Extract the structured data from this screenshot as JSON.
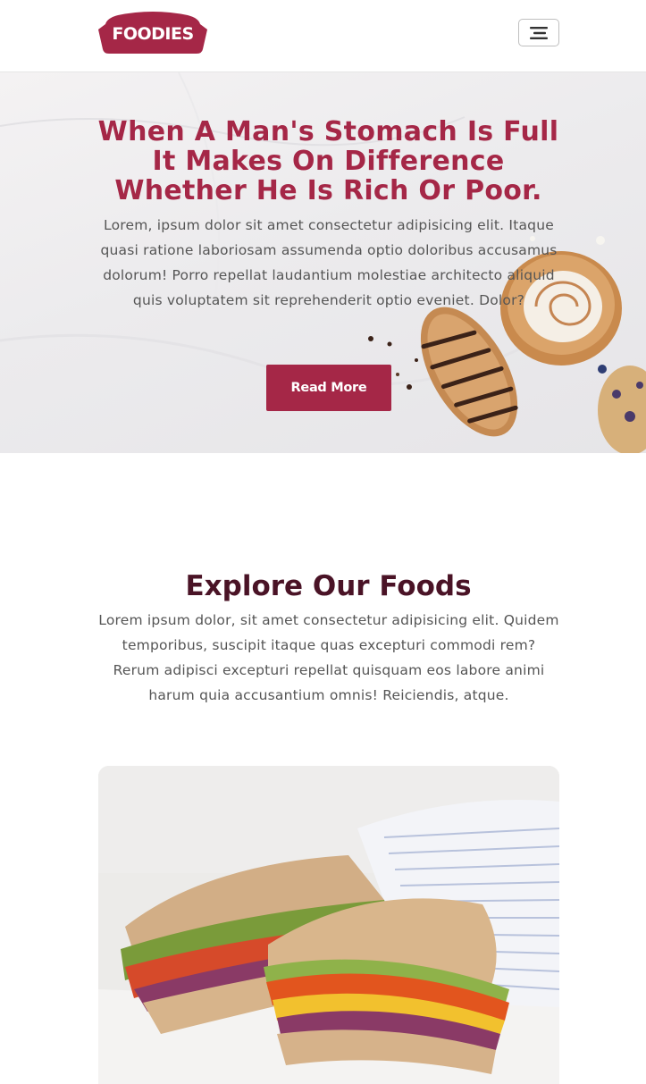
{
  "brand": {
    "name": "FOODIES",
    "color": "#a52747"
  },
  "header": {
    "menu_icon": "hamburger-icon"
  },
  "hero": {
    "title": "When A Man's Stomach Is Full It Makes On Difference Whether He Is Rich Or Poor.",
    "text": "Lorem, ipsum dolor sit amet consectetur adipisicing elit. Itaque quasi ratione laboriosam assumenda optio doloribus accusamus dolorum! Porro repellat laudantium molestiae architecto aliquid quis voluptatem sit reprehenderit optio eveniet. Dolor?",
    "button_label": "Read More"
  },
  "explore": {
    "title": "Explore Our Foods",
    "text": "Lorem ipsum dolor, sit amet consectetur adipisicing elit. Quidem temporibus, suscipit itaque quas excepturi commodi rem? Rerum adipisci excepturi repellat quisquam eos labore animi harum quia accusantium omnis! Reiciendis, atque."
  },
  "colors": {
    "accent": "#a52747",
    "heading_dark": "#4a1326",
    "body_text": "#555555"
  }
}
